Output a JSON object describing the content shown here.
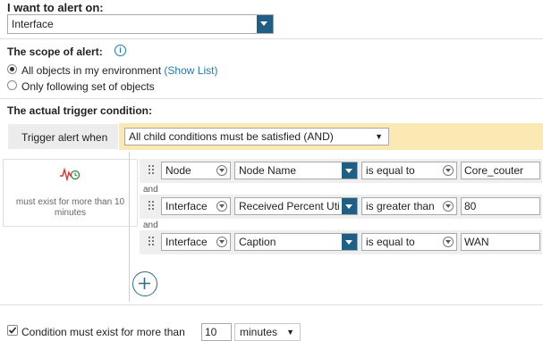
{
  "alert_on": {
    "label": "I want to alert on:",
    "value": "Interface"
  },
  "scope": {
    "label": "The scope of alert:",
    "info_icon": "info-icon",
    "option_all": "All objects in my environment",
    "show_list": "(Show List)",
    "option_following": "Only following set of objects"
  },
  "trigger": {
    "heading": "The actual trigger condition:",
    "when_label": "Trigger alert when",
    "when_value": "All child conditions must be satisfied (AND)",
    "summary_text": "must exist for more than 10 minutes",
    "conditions": [
      {
        "object": "Node",
        "field": "Node Name",
        "operator": "is equal to",
        "value": "Core_couter"
      },
      {
        "object": "Interface",
        "field": "Received Percent Uti",
        "operator": "is greater than",
        "value": "80"
      },
      {
        "object": "Interface",
        "field": "Caption",
        "operator": "is equal to",
        "value": "WAN"
      }
    ],
    "and_label": "and",
    "add_icon": "plus-icon"
  },
  "duration": {
    "label": "Condition must exist for more than",
    "value": "10",
    "unit": "minutes"
  },
  "colors": {
    "accent": "#1f5f85",
    "highlight": "#fbe9b4",
    "row_bg": "#efefef"
  }
}
